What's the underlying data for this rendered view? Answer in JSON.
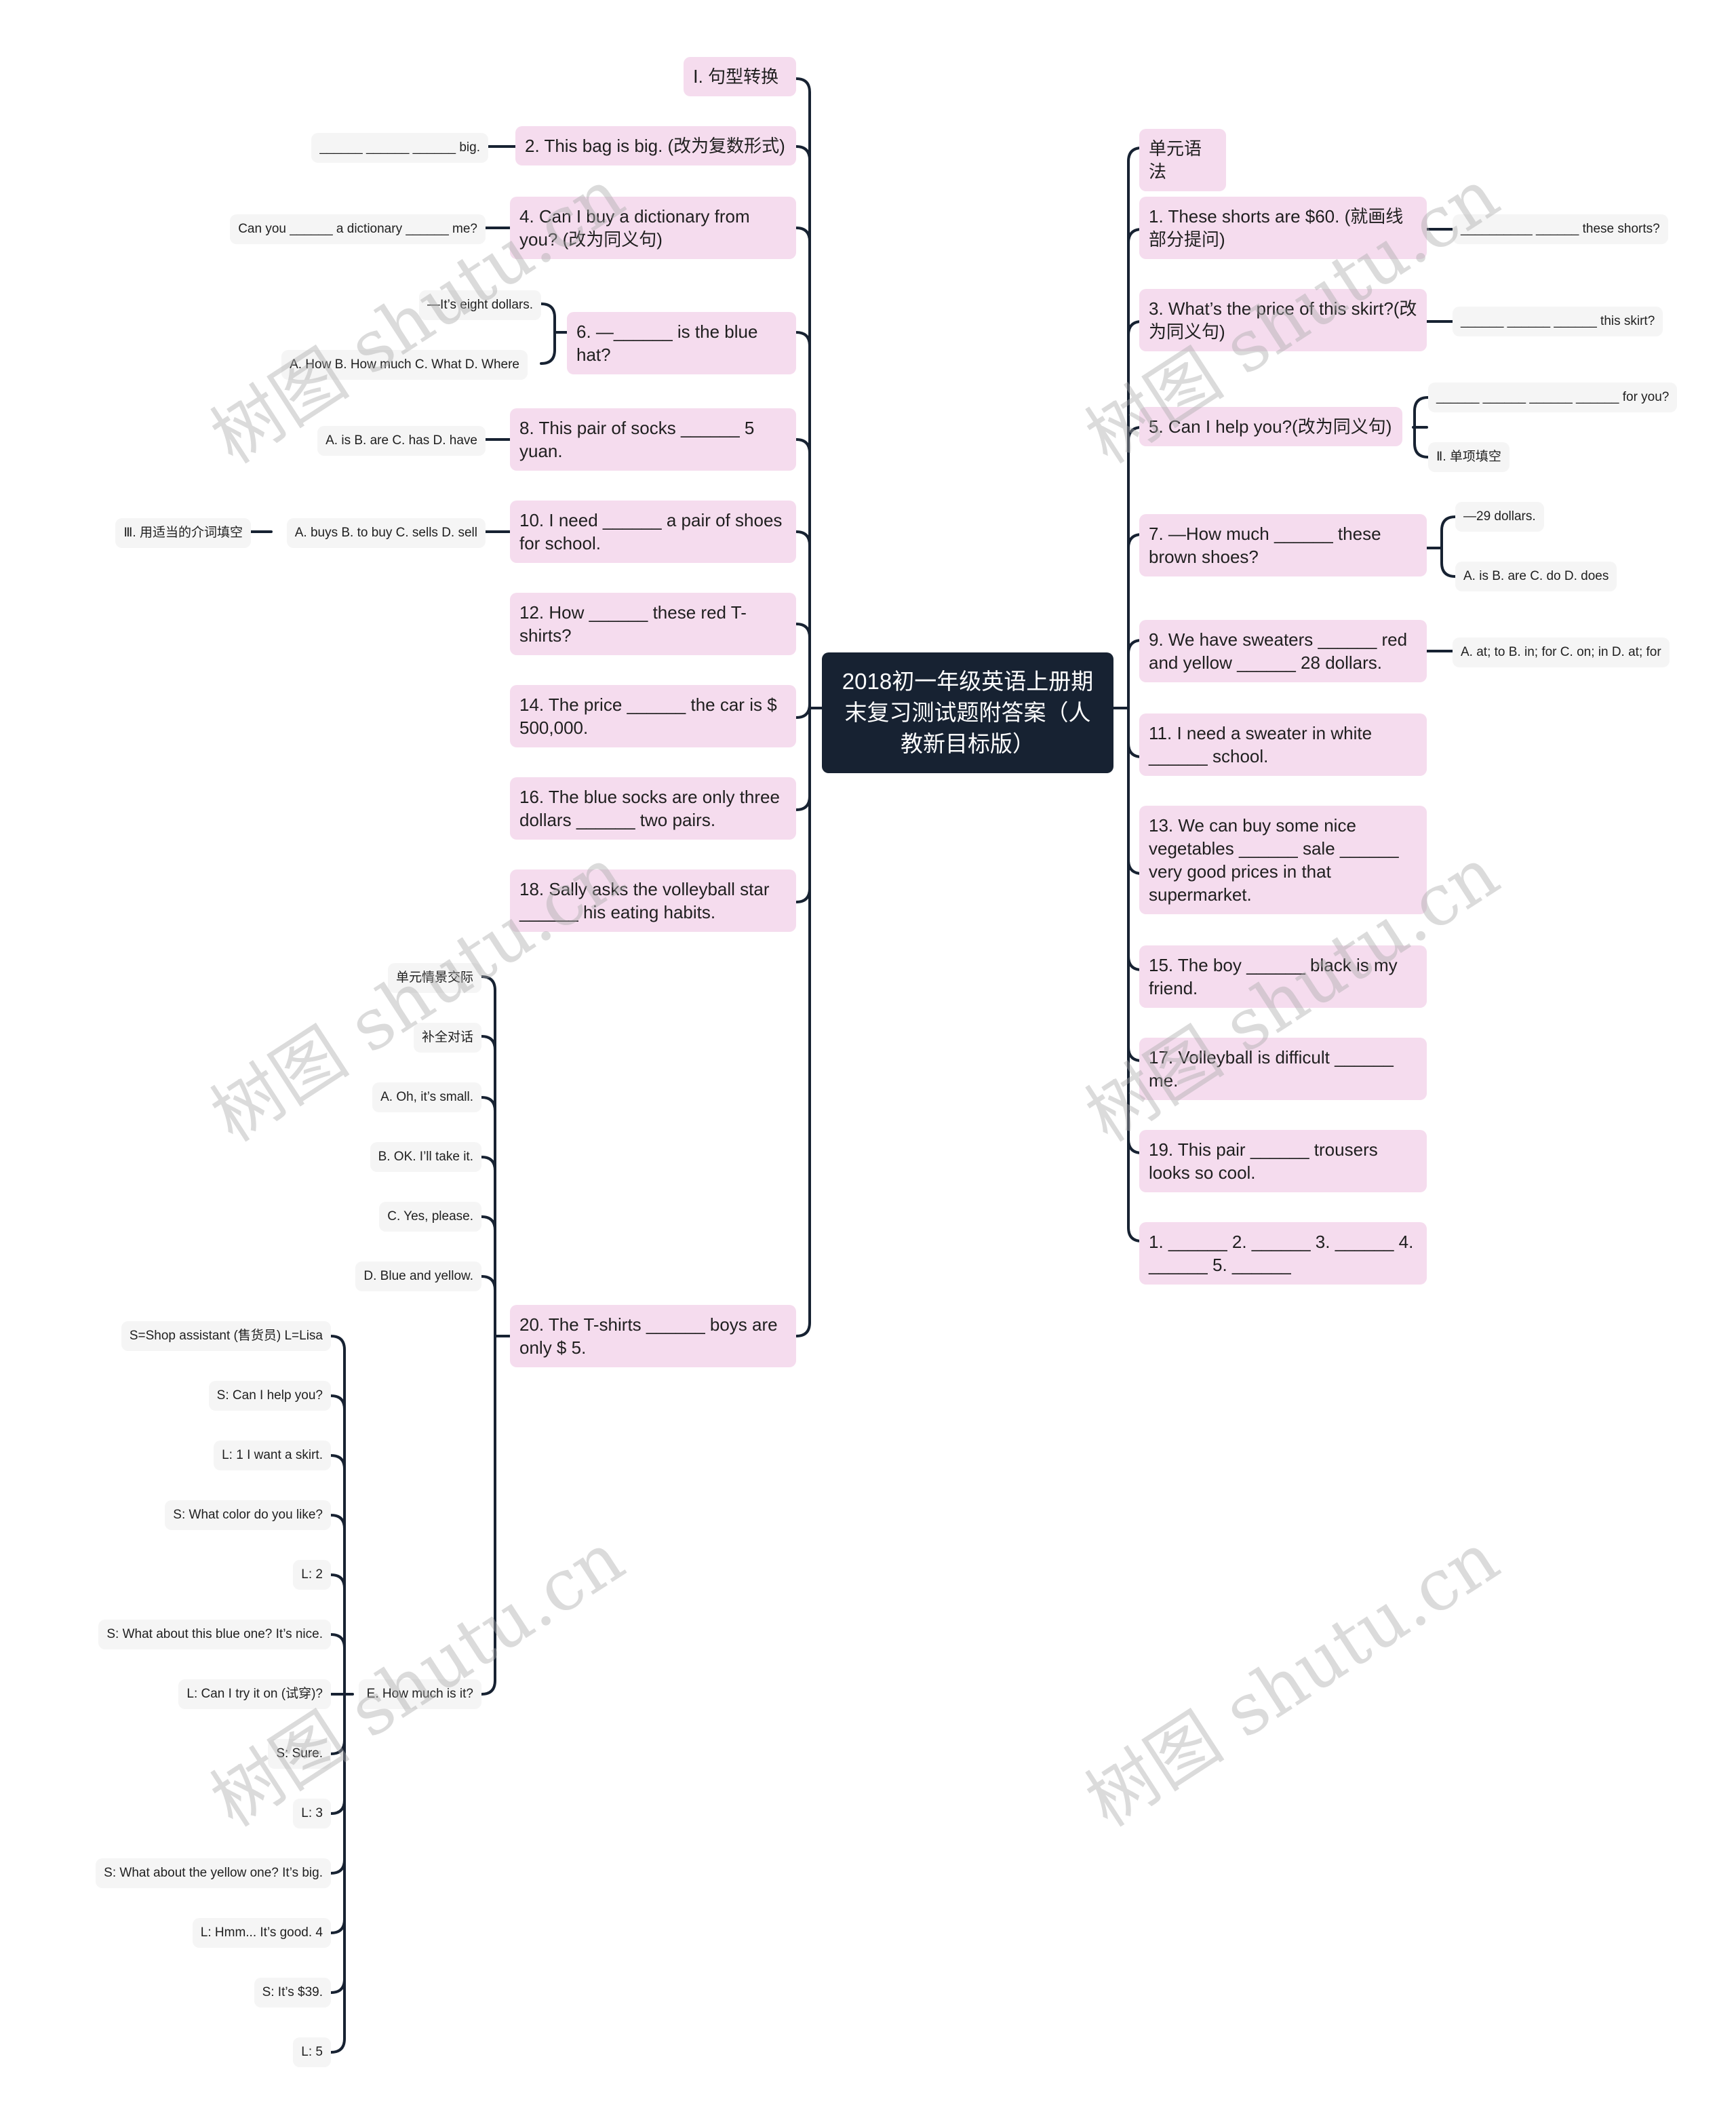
{
  "root": {
    "title": "2018初一年级英语上册期末复习测试题附答案（人教新目标版）"
  },
  "left": {
    "items": [
      {
        "label": "Ⅰ. 句型转换"
      },
      {
        "label": "2. This bag is big. (改为复数形式)",
        "children": [
          "______ ______ ______ big."
        ]
      },
      {
        "label": "4. Can I buy a dictionary from you? (改为同义句)",
        "children": [
          "Can you ______ a dictionary ______ me?"
        ]
      },
      {
        "label": "6. —______ is the blue hat?",
        "children": [
          "—It’s eight dollars.",
          "A. How B. How much C. What D. Where"
        ]
      },
      {
        "label": "8. This pair of socks ______ 5 yuan.",
        "children": [
          "A. is B. are C. has D. have"
        ]
      },
      {
        "label": "10. I need ______ a pair of shoes  for school.",
        "children": [
          "A. buys B. to buy C. sells D. sell"
        ],
        "grandchild": "Ⅲ. 用适当的介词填空"
      },
      {
        "label": "12. How ______ these red T-shirts?"
      },
      {
        "label": "14. The price ______ the car is $ 500,000."
      },
      {
        "label": "16. The blue socks are only three dollars ______ two pairs."
      },
      {
        "label": "18. Sally asks the volleyball star ______ his eating habits."
      },
      {
        "label": "20. The T-shirts ______ boys are only $ 5."
      }
    ],
    "q20_children": [
      "单元情景交际",
      "补全对话",
      "A. Oh, it’s small.",
      "B. OK. I’ll take it.",
      "C. Yes, please.",
      "D. Blue and yellow.",
      "E. How much is it?"
    ],
    "dialogue": [
      "S=Shop assistant (售货员) L=Lisa",
      "S: Can I help you?",
      "L: 1 I want a skirt.",
      "S: What color do you like?",
      "L: 2",
      "S: What about this blue one? It’s nice.",
      "L: Can I try it on (试穿)?",
      "S: Sure.",
      "L: 3",
      "S: What about the yellow one? It’s big.",
      "L: Hmm... It’s good. 4",
      "S: It’s $39.",
      "L: 5"
    ]
  },
  "right": {
    "items": [
      {
        "label": "单元语法"
      },
      {
        "label": "1. These shorts are $60. (就画线部分提问)",
        "children": [
          "__________ ______ these shorts?"
        ]
      },
      {
        "label": "3. What’s the price of this skirt?(改为同义句)",
        "children": [
          "______ ______ ______ this skirt?"
        ]
      },
      {
        "label": "5. Can I help you?(改为同义句)",
        "children": [
          "______ ______ ______ ______ for you?",
          "Ⅱ. 单项填空"
        ]
      },
      {
        "label": "7. —How much ______ these brown shoes?",
        "children": [
          "—29 dollars.",
          "A. is B. are C. do D. does"
        ]
      },
      {
        "label": "9. We have sweaters ______ red and yellow ______ 28 dollars.",
        "children": [
          "A. at; to B. in; for C. on; in D. at; for"
        ]
      },
      {
        "label": "11. I need a sweater in white ______ school."
      },
      {
        "label": "13. We can buy some nice vegetables ______ sale ______ very good prices in that supermarket."
      },
      {
        "label": "15. The boy ______ black is my friend."
      },
      {
        "label": "17. Volleyball is difficult ______ me."
      },
      {
        "label": "19. This pair ______ trousers looks so cool."
      },
      {
        "label": "1. ______ 2. ______ 3. ______ 4. ______ 5. ______"
      }
    ]
  },
  "watermark": {
    "text": "树图 shutu.cn"
  },
  "colors": {
    "root_bg": "#172232",
    "branch_bg": "#f5dcee",
    "leaf_bg": "#f5f5f5",
    "line": "#172232"
  }
}
